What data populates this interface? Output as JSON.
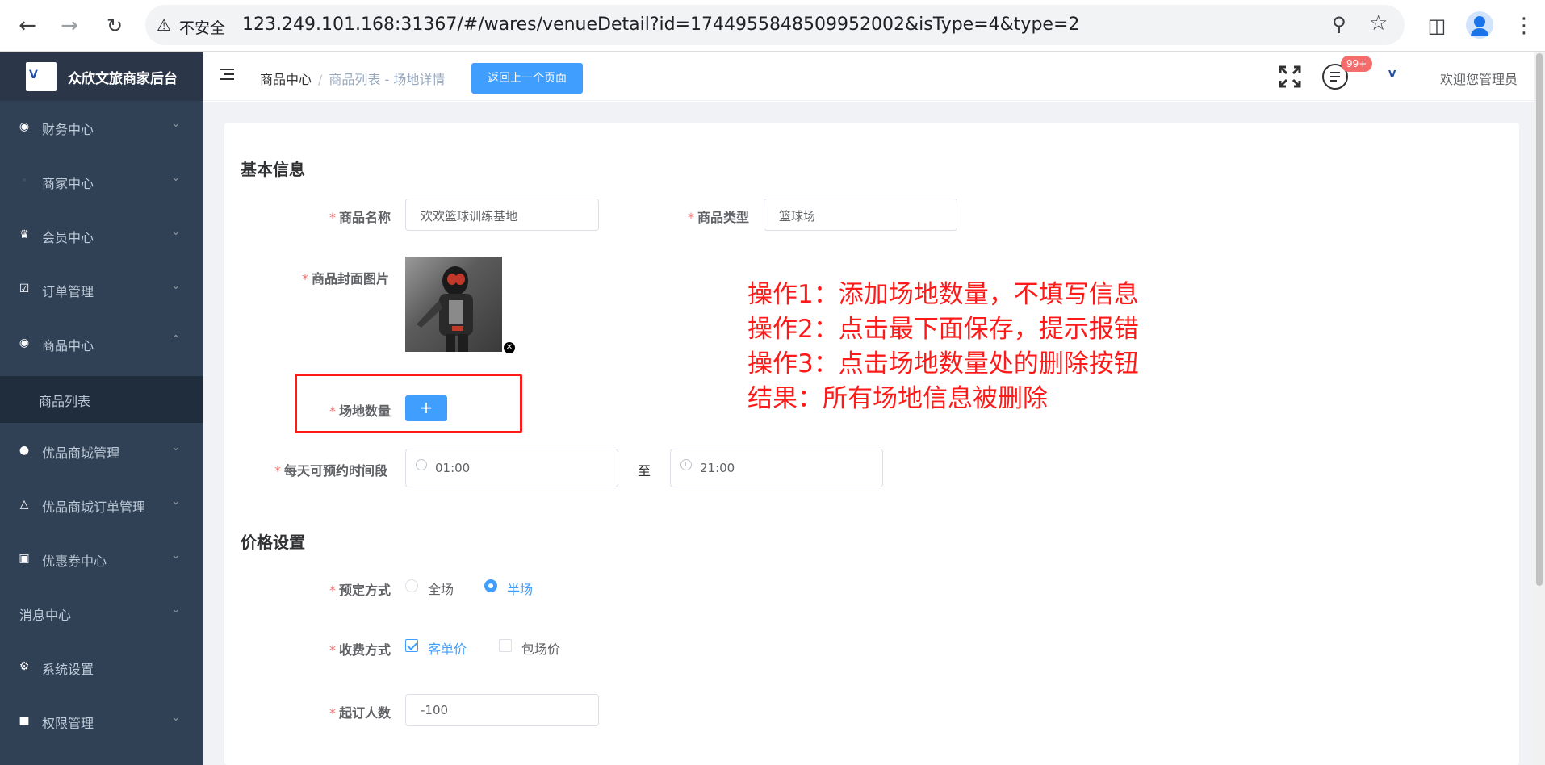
{
  "browser": {
    "security_label": "不安全",
    "url": "123.249.101.168:31367/#/wares/venueDetail?id=1744955848509952002&isType=4&type=2"
  },
  "sidebar": {
    "brand": "众欣文旅商家后台",
    "logo_text": "V",
    "items": [
      {
        "label": "财务中心",
        "icon": "money-bag-icon"
      },
      {
        "label": "商家中心",
        "icon": "shop-icon"
      },
      {
        "label": "会员中心",
        "icon": "crown-icon"
      },
      {
        "label": "订单管理",
        "icon": "clipboard-icon"
      },
      {
        "label": "商品中心",
        "icon": "goods-icon"
      },
      {
        "label": "商品列表"
      },
      {
        "label": "优品商城管理",
        "icon": "mall-icon"
      },
      {
        "label": "优品商城订单管理",
        "icon": "bell-icon"
      },
      {
        "label": "优惠券中心",
        "icon": "ticket-icon"
      },
      {
        "label": "消息中心"
      },
      {
        "label": "系统设置",
        "icon": "gear-icon"
      },
      {
        "label": "权限管理",
        "icon": "lock-icon"
      }
    ]
  },
  "header": {
    "breadcrumb_root": "商品中心",
    "breadcrumb_separator": "/",
    "breadcrumb_current": "商品列表 - 场地详情",
    "back_button": "返回上一个页面",
    "message_badge": "99+",
    "welcome": "欢迎您管理员"
  },
  "form": {
    "basic_title": "基本信息",
    "name_label": "商品名称",
    "name_value": "欢欢篮球训练基地",
    "type_label": "商品类型",
    "type_value": "篮球场",
    "cover_label": "商品封面图片",
    "venue_count_label": "场地数量",
    "add_button": "+",
    "time_label": "每天可预约时间段",
    "time_start": "01:00",
    "time_separator": "至",
    "time_end": "21:00",
    "price_title": "价格设置",
    "booking_label": "预定方式",
    "booking_options": [
      "全场",
      "半场"
    ],
    "booking_selected": "半场",
    "charge_label": "收费方式",
    "charge_options": [
      "客单价",
      "包场价"
    ],
    "charge_checked": "客单价",
    "min_people_label": "起订人数",
    "min_people_value": "-100",
    "required_mark": "*"
  },
  "annotation": {
    "lines": [
      "操作1：添加场地数量，不填写信息",
      "操作2：点击最下面保存，提示报错",
      "操作3：点击场地数量处的删除按钮",
      "结果：所有场地信息被删除"
    ]
  },
  "colors": {
    "sidebar_bg": "#304156",
    "primary": "#409eff",
    "annotation": "#ff1a1a",
    "required": "#f56c6c"
  }
}
